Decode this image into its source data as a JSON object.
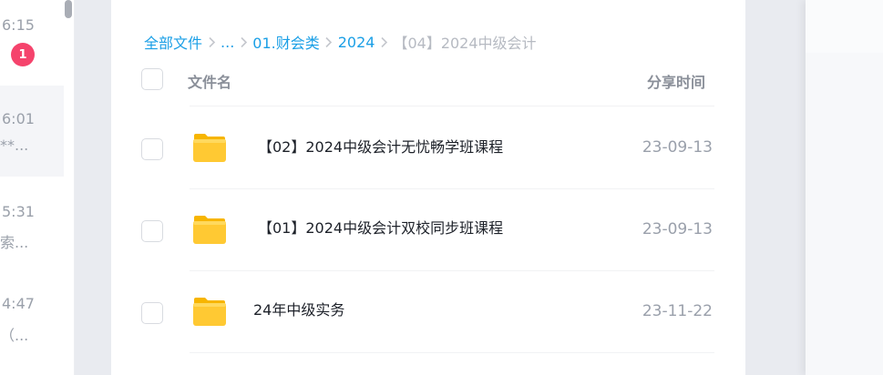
{
  "chat_list": {
    "items": [
      {
        "time": "6:15",
        "badge": "1",
        "snippet": ""
      },
      {
        "time": "6:01",
        "snippet": "**..."
      },
      {
        "time": "5:31",
        "snippet": "索..."
      },
      {
        "time": "4:47",
        "snippet": "（..."
      }
    ]
  },
  "breadcrumb": {
    "items": [
      "全部文件",
      "...",
      "01.财会类",
      "2024"
    ],
    "current": "【04】2024中级会计"
  },
  "table": {
    "headers": {
      "name": "文件名",
      "time": "分享时间"
    },
    "rows": [
      {
        "name": "【02】2024中级会计无忧畅学班课程",
        "date": "23-09-13",
        "icon": "folder-icon"
      },
      {
        "name": "【01】2024中级会计双校同步班课程",
        "date": "23-09-13",
        "icon": "folder-icon"
      },
      {
        "name": "24年中级实务",
        "date": "23-11-22",
        "icon": "folder-icon"
      }
    ]
  },
  "colors": {
    "link": "#1a9fe6",
    "badge": "#f5436c",
    "folder": "#ffc933"
  }
}
